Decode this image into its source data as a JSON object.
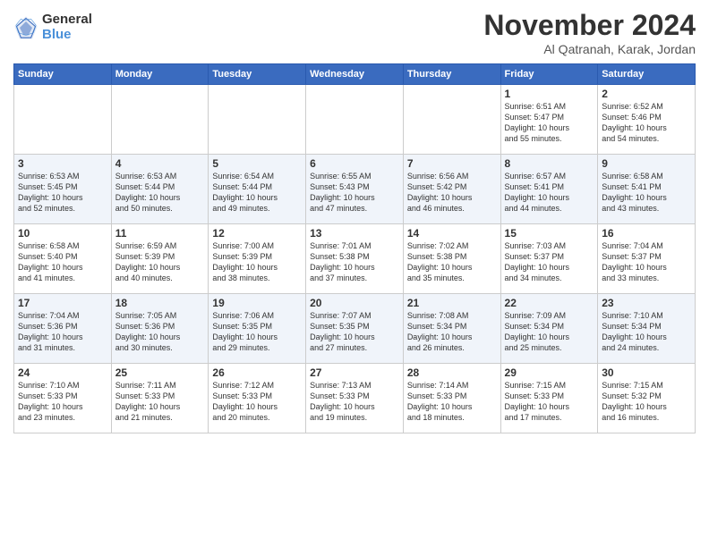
{
  "logo": {
    "general": "General",
    "blue": "Blue"
  },
  "header": {
    "month": "November 2024",
    "location": "Al Qatranah, Karak, Jordan"
  },
  "days": [
    "Sunday",
    "Monday",
    "Tuesday",
    "Wednesday",
    "Thursday",
    "Friday",
    "Saturday"
  ],
  "weeks": [
    [
      {
        "num": "",
        "info": ""
      },
      {
        "num": "",
        "info": ""
      },
      {
        "num": "",
        "info": ""
      },
      {
        "num": "",
        "info": ""
      },
      {
        "num": "",
        "info": ""
      },
      {
        "num": "1",
        "info": "Sunrise: 6:51 AM\nSunset: 5:47 PM\nDaylight: 10 hours\nand 55 minutes."
      },
      {
        "num": "2",
        "info": "Sunrise: 6:52 AM\nSunset: 5:46 PM\nDaylight: 10 hours\nand 54 minutes."
      }
    ],
    [
      {
        "num": "3",
        "info": "Sunrise: 6:53 AM\nSunset: 5:45 PM\nDaylight: 10 hours\nand 52 minutes."
      },
      {
        "num": "4",
        "info": "Sunrise: 6:53 AM\nSunset: 5:44 PM\nDaylight: 10 hours\nand 50 minutes."
      },
      {
        "num": "5",
        "info": "Sunrise: 6:54 AM\nSunset: 5:44 PM\nDaylight: 10 hours\nand 49 minutes."
      },
      {
        "num": "6",
        "info": "Sunrise: 6:55 AM\nSunset: 5:43 PM\nDaylight: 10 hours\nand 47 minutes."
      },
      {
        "num": "7",
        "info": "Sunrise: 6:56 AM\nSunset: 5:42 PM\nDaylight: 10 hours\nand 46 minutes."
      },
      {
        "num": "8",
        "info": "Sunrise: 6:57 AM\nSunset: 5:41 PM\nDaylight: 10 hours\nand 44 minutes."
      },
      {
        "num": "9",
        "info": "Sunrise: 6:58 AM\nSunset: 5:41 PM\nDaylight: 10 hours\nand 43 minutes."
      }
    ],
    [
      {
        "num": "10",
        "info": "Sunrise: 6:58 AM\nSunset: 5:40 PM\nDaylight: 10 hours\nand 41 minutes."
      },
      {
        "num": "11",
        "info": "Sunrise: 6:59 AM\nSunset: 5:39 PM\nDaylight: 10 hours\nand 40 minutes."
      },
      {
        "num": "12",
        "info": "Sunrise: 7:00 AM\nSunset: 5:39 PM\nDaylight: 10 hours\nand 38 minutes."
      },
      {
        "num": "13",
        "info": "Sunrise: 7:01 AM\nSunset: 5:38 PM\nDaylight: 10 hours\nand 37 minutes."
      },
      {
        "num": "14",
        "info": "Sunrise: 7:02 AM\nSunset: 5:38 PM\nDaylight: 10 hours\nand 35 minutes."
      },
      {
        "num": "15",
        "info": "Sunrise: 7:03 AM\nSunset: 5:37 PM\nDaylight: 10 hours\nand 34 minutes."
      },
      {
        "num": "16",
        "info": "Sunrise: 7:04 AM\nSunset: 5:37 PM\nDaylight: 10 hours\nand 33 minutes."
      }
    ],
    [
      {
        "num": "17",
        "info": "Sunrise: 7:04 AM\nSunset: 5:36 PM\nDaylight: 10 hours\nand 31 minutes."
      },
      {
        "num": "18",
        "info": "Sunrise: 7:05 AM\nSunset: 5:36 PM\nDaylight: 10 hours\nand 30 minutes."
      },
      {
        "num": "19",
        "info": "Sunrise: 7:06 AM\nSunset: 5:35 PM\nDaylight: 10 hours\nand 29 minutes."
      },
      {
        "num": "20",
        "info": "Sunrise: 7:07 AM\nSunset: 5:35 PM\nDaylight: 10 hours\nand 27 minutes."
      },
      {
        "num": "21",
        "info": "Sunrise: 7:08 AM\nSunset: 5:34 PM\nDaylight: 10 hours\nand 26 minutes."
      },
      {
        "num": "22",
        "info": "Sunrise: 7:09 AM\nSunset: 5:34 PM\nDaylight: 10 hours\nand 25 minutes."
      },
      {
        "num": "23",
        "info": "Sunrise: 7:10 AM\nSunset: 5:34 PM\nDaylight: 10 hours\nand 24 minutes."
      }
    ],
    [
      {
        "num": "24",
        "info": "Sunrise: 7:10 AM\nSunset: 5:33 PM\nDaylight: 10 hours\nand 23 minutes."
      },
      {
        "num": "25",
        "info": "Sunrise: 7:11 AM\nSunset: 5:33 PM\nDaylight: 10 hours\nand 21 minutes."
      },
      {
        "num": "26",
        "info": "Sunrise: 7:12 AM\nSunset: 5:33 PM\nDaylight: 10 hours\nand 20 minutes."
      },
      {
        "num": "27",
        "info": "Sunrise: 7:13 AM\nSunset: 5:33 PM\nDaylight: 10 hours\nand 19 minutes."
      },
      {
        "num": "28",
        "info": "Sunrise: 7:14 AM\nSunset: 5:33 PM\nDaylight: 10 hours\nand 18 minutes."
      },
      {
        "num": "29",
        "info": "Sunrise: 7:15 AM\nSunset: 5:33 PM\nDaylight: 10 hours\nand 17 minutes."
      },
      {
        "num": "30",
        "info": "Sunrise: 7:15 AM\nSunset: 5:32 PM\nDaylight: 10 hours\nand 16 minutes."
      }
    ]
  ]
}
